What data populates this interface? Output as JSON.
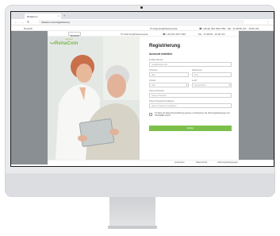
{
  "browser": {
    "tab_title": "RehaCom",
    "tab_close": "×",
    "new_tab": "+",
    "back": "←",
    "forward": "→",
    "reload": "↻",
    "url": "rehacom.com/registrierung",
    "menu": "⋮"
  },
  "top_info": {
    "language": "Deutsch",
    "email": "✉ rehacom@hasomed.de",
    "phone": "☎ +49 (0) 391 6107 650 · Mo - Fr 08:00 Uhr - 16:00 Uhr"
  },
  "site_bar": {
    "language": "Deutsch",
    "email": "✉ rehacom@hasomed.de",
    "phone": "☎ +49 391 6107 650",
    "hours": "Mo - Fr 08:00 - 16:00 Uhr"
  },
  "logo": {
    "text": "RehaCom",
    "company": "HASOMED"
  },
  "form": {
    "title": "Registrierung",
    "subtitle": "Account erstellen",
    "email_label": "E-Mail-Adresse",
    "email_placeholder": "max@beispiel.de",
    "firstname_label": "Vorname",
    "firstname_value": "Max",
    "lastname_label": "Nachname",
    "lastname_value": "Test",
    "salutation_label": "Anrede",
    "salutation_value": "Herr",
    "country_label": "Land",
    "country_value": "Deutschland",
    "password_label": "Neues Passwort",
    "password_placeholder": "Neues Passwort",
    "password_repeat_label": "Neues Passwort bestätigen",
    "password_repeat_placeholder": "Neues Passwort bestätigen",
    "consent_text": "Ich habe die Datenschutzerklärung gelesen und akzeptiere die Nutzungsbedingungen der HASOMED GmbH.",
    "submit_label": "Weiter",
    "select_arrow": "▾"
  },
  "footer": {
    "imprint": "Impressum",
    "privacy": "Datenschutz",
    "terms": "Nutzungsbedingungen"
  },
  "colors": {
    "brand_green": "#7cc04b",
    "side_gray": "#8a8f94"
  }
}
